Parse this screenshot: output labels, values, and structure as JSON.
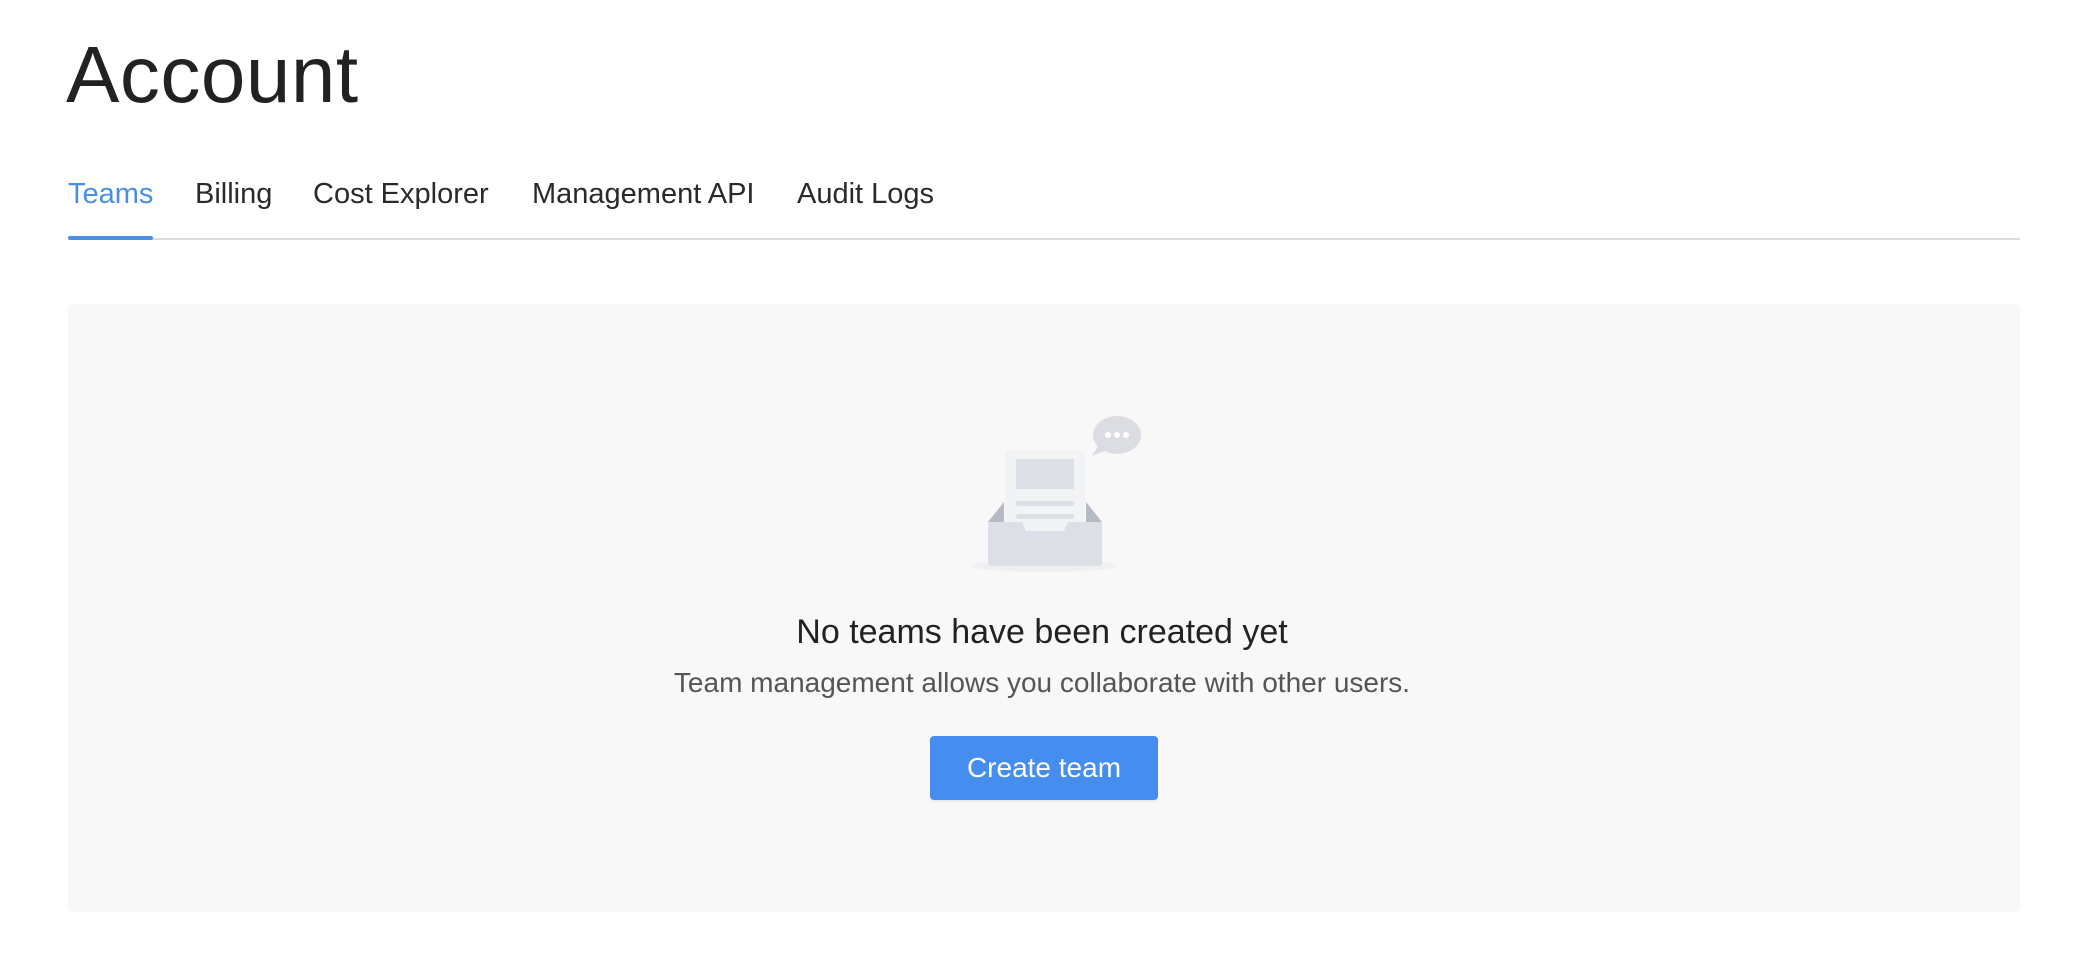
{
  "page": {
    "title": "Account"
  },
  "tabs": [
    {
      "label": "Teams",
      "active": true
    },
    {
      "label": "Billing",
      "active": false
    },
    {
      "label": "Cost Explorer",
      "active": false
    },
    {
      "label": "Management API",
      "active": false
    },
    {
      "label": "Audit Logs",
      "active": false
    }
  ],
  "empty_state": {
    "icon": "empty-inbox-icon",
    "title": "No teams have been created yet",
    "description": "Team management allows you collaborate with other users.",
    "button_label": "Create team"
  },
  "colors": {
    "accent": "#458ef0",
    "active_tab": "#4a8fe6",
    "panel_background": "#f8f8f8"
  }
}
